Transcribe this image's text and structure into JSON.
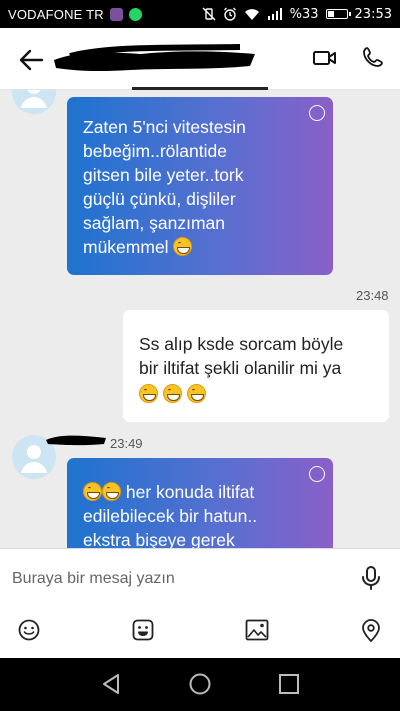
{
  "status_bar": {
    "carrier": "VODAFONE TR",
    "battery": "%33",
    "time": "23:53",
    "battery_level": 0.33
  },
  "header": {
    "back_icon": "arrow-left-icon",
    "video_icon": "video-call-icon",
    "call_icon": "phone-icon"
  },
  "messages": [
    {
      "direction": "incoming",
      "lines": [
        "Zaten 5'nci vitestesin",
        "bebeğim..rölantide",
        "gitsen bile yeter..tork",
        "güçlü çünkü, dişliler",
        "sağlam, şanzıman",
        "mükemmel"
      ]
    },
    {
      "direction": "outgoing",
      "time": "23:48",
      "lines": [
        "Ss alıp ksde sorcam böyle",
        "bir iltifat şekli olanilir mi ya"
      ]
    },
    {
      "direction": "incoming",
      "time": "23:49",
      "lines": [
        "her konuda iltifat",
        "edilebilecek bir hatun..",
        "ekstra bişeye gerek"
      ]
    }
  ],
  "composer": {
    "placeholder": "Buraya bir mesaj yazın"
  },
  "colors": {
    "bubble_gradient_start": "#1f73cf",
    "bubble_gradient_end": "#8a5fc8",
    "chat_background": "#ececec"
  }
}
